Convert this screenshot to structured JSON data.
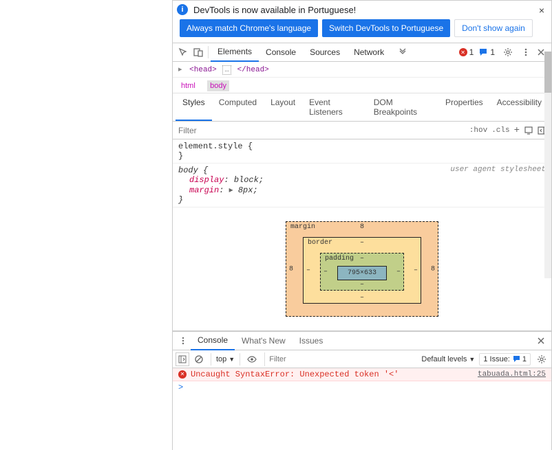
{
  "banner": {
    "text": "DevTools is now available in Portuguese!",
    "always_match": "Always match Chrome's language",
    "switch_lang": "Switch DevTools to Portuguese",
    "dont_show": "Don't show again",
    "close": "×"
  },
  "tabs": {
    "elements": "Elements",
    "console": "Console",
    "sources": "Sources",
    "network": "Network"
  },
  "badges": {
    "error_count": "1",
    "issue_count": "1"
  },
  "elements": {
    "line_open": "<head>",
    "line_close": "</head>",
    "dots": "…"
  },
  "breadcrumb": {
    "html": "html",
    "body": "body"
  },
  "styles_tabs": {
    "styles": "Styles",
    "computed": "Computed",
    "layout": "Layout",
    "event": "Event Listeners",
    "dom": "DOM Breakpoints",
    "properties": "Properties",
    "accessibility": "Accessibility"
  },
  "filter": {
    "placeholder": "Filter",
    "hov": ":hov",
    "cls": ".cls"
  },
  "rules": {
    "element_style": "element.style {",
    "close_brace": "}",
    "body_selector": "body {",
    "display_name": "display",
    "display_value": "block",
    "margin_name": "margin",
    "margin_arrow": "▸",
    "margin_value": "8px",
    "ua_label": "user agent stylesheet"
  },
  "box_model": {
    "margin_label": "margin",
    "margin_val": "8",
    "border_label": "border",
    "border_val": "–",
    "padding_label": "padding",
    "padding_val": "–",
    "content": "795×633"
  },
  "drawer": {
    "console": "Console",
    "whats_new": "What's New",
    "issues": "Issues",
    "close": "×"
  },
  "console": {
    "context": "top",
    "filter_placeholder": "Filter",
    "levels": "Default levels",
    "issue_label": "1 Issue:",
    "issue_count": "1",
    "error_text": "Uncaught SyntaxError: Unexpected token '<'",
    "error_src": "tabuada.html:25",
    "prompt": ">"
  }
}
